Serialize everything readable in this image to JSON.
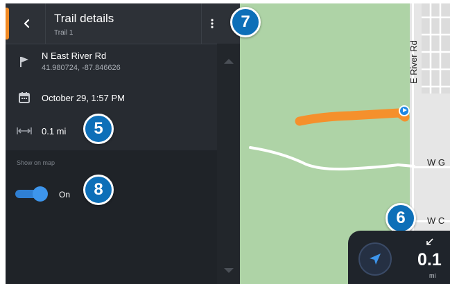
{
  "header": {
    "title": "Trail details",
    "subtitle": "Trail 1"
  },
  "details": {
    "location_name": "N East River Rd",
    "coordinates": "41.980724, -87.846626",
    "date": "October 29, 1:57 PM",
    "distance": "0.1 mi"
  },
  "show_on_map": {
    "label": "Show on map",
    "state": "On",
    "enabled": true
  },
  "map": {
    "street_vertical": "E River Rd",
    "street_1": "W G",
    "street_2": "W C",
    "trail_color": "#f5902c",
    "park_color": "#aed3a6"
  },
  "badges": {
    "more": "7",
    "distance": "5",
    "toggle": "8",
    "nav": "6"
  },
  "nav_widget": {
    "distance_value": "0.1",
    "distance_unit": "mi"
  },
  "colors": {
    "accent": "#f08a24",
    "toggle": "#3d95ec",
    "badge": "#0d6fb8"
  }
}
